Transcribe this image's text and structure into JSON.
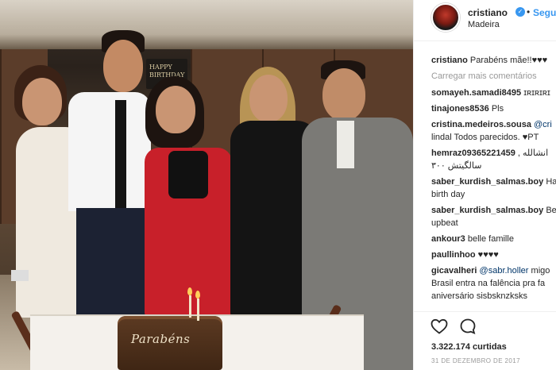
{
  "post": {
    "username": "cristiano",
    "follow_label": "Seguir",
    "separator": "•",
    "verified_mark": "✓",
    "location": "Madeira",
    "cake_text": "Parabéns",
    "sign_text": "HAPPY BIRTHDAY"
  },
  "caption": {
    "user": "cristiano",
    "text": "Parabéns mãe!!♥♥♥"
  },
  "load_more": "Carregar mais comentários",
  "comments": [
    {
      "user": "somayeh.samadi8495",
      "text": "ɪʀɪʀɪʀɪ"
    },
    {
      "user": "tinajones8536",
      "text": "Pls"
    },
    {
      "user": "cristina.medeiros.sousa",
      "mention": "@cri",
      "text2": "lindal Todos parecidos. ♥PT"
    },
    {
      "user": "hemraz09365221459",
      "text": ", انشالله",
      "text2": "۳۰۰ سالگیتش"
    },
    {
      "user": "saber_kurdish_salmas.boy",
      "text": "Ha",
      "text2": "birth day"
    },
    {
      "user": "saber_kurdish_salmas.boy",
      "text": "Be",
      "text2": "upbeat"
    },
    {
      "user": "ankour3",
      "text": "belle famille"
    },
    {
      "user": "paullinhoo",
      "text": "♥♥♥♥"
    },
    {
      "user": "gicavalheri",
      "mention": "@sabr.holler",
      "text": "migo",
      "text2": "Brasil entra na falência pra fa",
      "text3": "aniversário sisbsknzksks"
    }
  ],
  "likes": "3.322.174 curtidas",
  "date": "31 DE DEZEMBRO DE 2017",
  "icons": {
    "like": "heart-icon",
    "comment": "comment-icon"
  },
  "colors": {
    "accent": "#3897f0",
    "text": "#262626",
    "muted": "#999999",
    "mention": "#003569"
  }
}
